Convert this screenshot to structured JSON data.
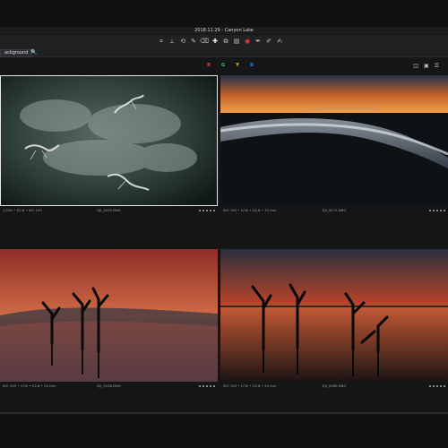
{
  "window": {
    "title": "2018.11.29 - Canyon Lake"
  },
  "toolbar": {
    "tools": [
      {
        "icon": "crop-icon"
      },
      {
        "icon": "straighten-icon"
      },
      {
        "icon": "rotate-icon"
      },
      {
        "icon": "brush-icon"
      },
      {
        "icon": "eraser-icon"
      },
      {
        "icon": "heal-icon"
      },
      {
        "icon": "clone-icon"
      },
      {
        "icon": "gradient-icon"
      },
      {
        "icon": "radial-icon"
      },
      {
        "icon": "redeye-icon"
      },
      {
        "icon": "picker-icon"
      },
      {
        "icon": "annotation-icon"
      }
    ],
    "background_selector": "ackground",
    "search_glyph": "🔍",
    "labels": [
      {
        "text": "R",
        "color": "#ff3b30"
      },
      {
        "text": "G",
        "color": "#34c759"
      },
      {
        "text": "Y",
        "color": "#ffd60a"
      },
      {
        "text": "B",
        "color": "#0a84ff"
      }
    ],
    "right_tools": [
      "◫",
      "▣",
      "☰"
    ]
  },
  "viewer": {
    "images": [
      {
        "id": "img1",
        "scene": "foggy lake aerial with floating dead trees",
        "meta_left": "1/250 • f/2.8 • ISO 100",
        "meta_mid": "DJI_0035.DNG",
        "meta_right": [
          "dot",
          "dot",
          "dot",
          "dot",
          "dot"
        ],
        "selected": true,
        "colors": {
          "base": "#1a2622",
          "glow": "#3b4b45",
          "mist": "#5a6a64"
        }
      },
      {
        "id": "img2",
        "scene": "sunset lake shoreline aerial",
        "meta_left": "ISO 100 • 1/30 • f/2.8 • 35 mm",
        "meta_mid": "DJI_0071.DNG",
        "meta_right": [
          "dot",
          "dot",
          "dot",
          "dot",
          "dot"
        ],
        "selected": false,
        "colors": {
          "sky": "#c6642c",
          "sky2": "#25324a",
          "water": "#7b8797",
          "land": "#0f1214"
        }
      },
      {
        "id": "img3",
        "scene": "red sunset sky with dead trees and reflections",
        "meta_left": "ISO 100 • 1/30 • f/2.8 • 24 mm",
        "meta_mid": "DJI_0036.DNG",
        "meta_right": [
          "dot",
          "dot",
          "dot",
          "dot",
          "dot"
        ],
        "selected": false,
        "colors": {
          "sky": "#8e2d27",
          "sky2": "#d06b45",
          "water": "#b84c3e",
          "trees": "#0a0a0b"
        }
      },
      {
        "id": "img4",
        "scene": "lake sunset with dead trees silhouettes",
        "meta_left": "ISO 100 • 1/30 • f/2.8 • 24 mm",
        "meta_mid": "DJI_0060.DNG",
        "meta_right": [
          "dot",
          "dot",
          "dot",
          "dot",
          "dot"
        ],
        "selected": false,
        "colors": {
          "sky": "#b3432a",
          "sky2": "#2a2f3d",
          "water": "#c55935",
          "trees": "#070707"
        }
      }
    ]
  }
}
